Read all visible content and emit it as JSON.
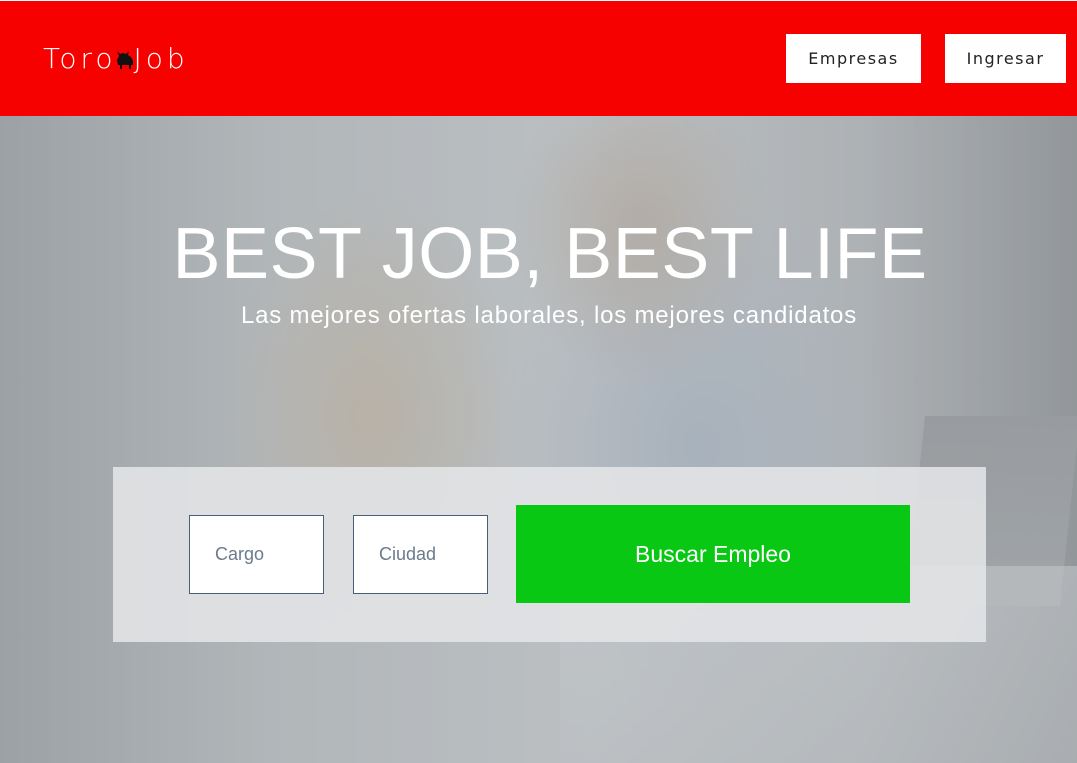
{
  "brand": {
    "name_part1": "Toro",
    "name_part2": "Job",
    "logo_icon": "bull-icon"
  },
  "nav": {
    "empresas_label": "Empresas",
    "ingresar_label": "Ingresar"
  },
  "hero": {
    "title": "BEST JOB, BEST LIFE",
    "subtitle": "Las mejores ofertas laborales, los mejores candidatos"
  },
  "search": {
    "cargo_placeholder": "Cargo",
    "ciudad_placeholder": "Ciudad",
    "button_label": "Buscar Empleo"
  },
  "colors": {
    "brand_red": "#f70000",
    "search_green": "#08c814"
  }
}
